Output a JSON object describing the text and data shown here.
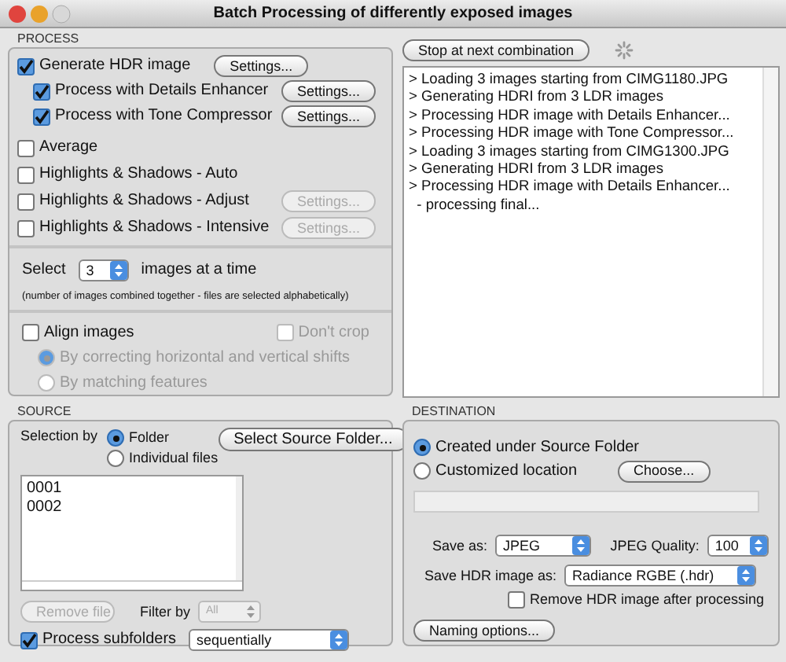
{
  "window": {
    "title": "Batch Processing of differently exposed images"
  },
  "process": {
    "title": "PROCESS",
    "options": [
      {
        "label": "Generate HDR image",
        "checked": true,
        "settings": {
          "label": "Settings...",
          "disabled": false
        },
        "children": [
          {
            "label": "Process with Details Enhancer",
            "checked": true,
            "settings": {
              "label": "Settings...",
              "disabled": false
            }
          },
          {
            "label": "Process with Tone Compressor",
            "checked": true,
            "settings": {
              "label": "Settings...",
              "disabled": false
            }
          }
        ]
      },
      {
        "label": "Average",
        "checked": false
      },
      {
        "label": "Highlights & Shadows - Auto",
        "checked": false
      },
      {
        "label": "Highlights & Shadows - Adjust",
        "checked": false,
        "settings": {
          "label": "Settings...",
          "disabled": true
        }
      },
      {
        "label": "Highlights & Shadows - Intensive",
        "checked": false,
        "settings": {
          "label": "Settings...",
          "disabled": true
        }
      }
    ],
    "select": {
      "label": "Select",
      "value": "3",
      "suffix": "images at a time",
      "note": "(number of images combined together - files are selected alphabetically)"
    },
    "align": {
      "label": "Align images",
      "checked": false,
      "dont_crop": {
        "label": "Don't crop",
        "checked": false,
        "disabled": true
      },
      "methods": [
        {
          "label": "By correcting horizontal and vertical shifts",
          "selected": true,
          "disabled": true
        },
        {
          "label": "By matching features",
          "selected": false,
          "disabled": true
        }
      ]
    }
  },
  "stop_button": "Stop at next combination",
  "log": [
    "> Loading 3 images starting from CIMG1180.JPG",
    "> Generating HDRI from 3 LDR images",
    "> Processing HDR image with Details Enhancer...",
    "> Processing HDR image with Tone Compressor...",
    "> Loading 3 images starting from CIMG1300.JPG",
    "> Generating HDRI from 3 LDR images",
    "> Processing HDR image with Details Enhancer...",
    "  - processing final..."
  ],
  "source": {
    "title": "SOURCE",
    "selection_label": "Selection by",
    "modes": [
      {
        "label": "Folder",
        "selected": true
      },
      {
        "label": "Individual files",
        "selected": false
      }
    ],
    "select_button": "Select Source Folder...",
    "files": [
      "0001",
      "0002"
    ],
    "remove_button": {
      "label": "Remove file",
      "disabled": true
    },
    "filter": {
      "label": "Filter by",
      "value": "All",
      "disabled": true
    },
    "subfolders": {
      "label": "Process subfolders",
      "checked": true
    },
    "order": "sequentially"
  },
  "destination": {
    "title": "DESTINATION",
    "locations": [
      {
        "label": "Created under Source Folder",
        "selected": true
      },
      {
        "label": "Customized location",
        "selected": false
      }
    ],
    "choose_button": "Choose...",
    "save_as": {
      "label": "Save as:",
      "value": "JPEG"
    },
    "quality": {
      "label": "JPEG Quality:",
      "value": "100"
    },
    "hdr_format": {
      "label": "Save HDR image as:",
      "value": "Radiance RGBE (.hdr)"
    },
    "remove_hdr": {
      "label": "Remove HDR image after processing",
      "checked": false
    },
    "naming_button": "Naming options..."
  }
}
